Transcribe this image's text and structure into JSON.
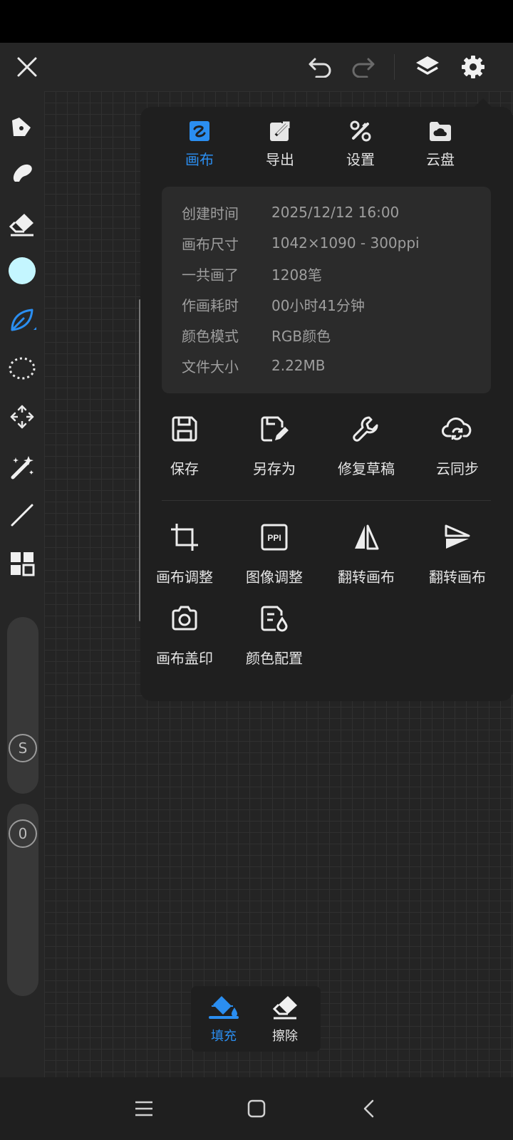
{
  "tabs": [
    {
      "label": "画布",
      "icon": "canvas-icon",
      "active": true
    },
    {
      "label": "导出",
      "icon": "export-icon",
      "active": false
    },
    {
      "label": "设置",
      "icon": "tools-icon",
      "active": false
    },
    {
      "label": "云盘",
      "icon": "cloud-folder-icon",
      "active": false
    }
  ],
  "info": [
    {
      "key": "创建时间",
      "value": "2025/12/12 16:00"
    },
    {
      "key": "画布尺寸",
      "value": "1042×1090 - 300ppi"
    },
    {
      "key": "一共画了",
      "value": "1208笔"
    },
    {
      "key": "作画耗时",
      "value": "00小时41分钟"
    },
    {
      "key": "颜色模式",
      "value": "RGB颜色"
    },
    {
      "key": "文件大小",
      "value": "2.22MB"
    }
  ],
  "actions_row1": [
    {
      "label": "保存",
      "icon": "save-icon"
    },
    {
      "label": "另存为",
      "icon": "save-as-icon"
    },
    {
      "label": "修复草稿",
      "icon": "wrench-icon"
    },
    {
      "label": "云同步",
      "icon": "cloud-sync-icon"
    }
  ],
  "actions_row2": [
    {
      "label": "画布调整",
      "icon": "crop-icon"
    },
    {
      "label": "图像调整",
      "icon": "ppi-icon"
    },
    {
      "label": "翻转画布",
      "icon": "flip-horizontal-icon"
    },
    {
      "label": "翻转画布",
      "icon": "flip-vertical-icon"
    }
  ],
  "actions_row3": [
    {
      "label": "画布盖印",
      "icon": "camera-icon"
    },
    {
      "label": "颜色配置",
      "icon": "color-profile-icon"
    }
  ],
  "fill_popup": [
    {
      "label": "填充",
      "icon": "paint-bucket-icon",
      "active": true
    },
    {
      "label": "擦除",
      "icon": "eraser-icon",
      "active": false
    }
  ],
  "sliders": {
    "size_knob": "S",
    "opacity_knob": "0"
  },
  "colors": {
    "accent": "#2b8ef0",
    "current_color": "#c4f6ff",
    "panel_bg": "#1f1f1f"
  }
}
